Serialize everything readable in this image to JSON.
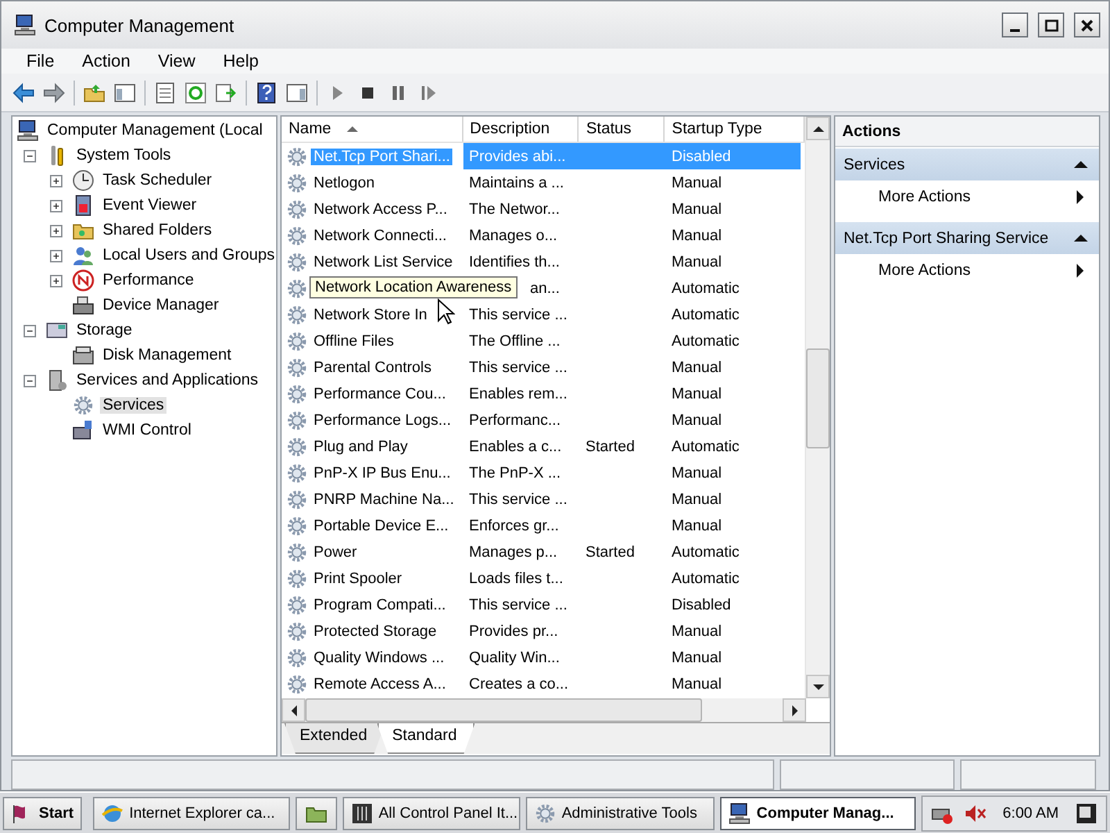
{
  "window": {
    "title": "Computer Management"
  },
  "menu": [
    "File",
    "Action",
    "View",
    "Help"
  ],
  "tree": [
    {
      "label": "Computer Management (Local",
      "selected": false,
      "children": [
        {
          "label": "System Tools",
          "expanded": true,
          "selected": false,
          "children": [
            {
              "label": "Task Scheduler",
              "expanded": false,
              "selected": false
            },
            {
              "label": "Event Viewer",
              "expanded": false,
              "selected": false
            },
            {
              "label": "Shared Folders",
              "expanded": false,
              "selected": false
            },
            {
              "label": "Local Users and Groups",
              "expanded": false,
              "selected": false
            },
            {
              "label": "Performance",
              "expanded": false,
              "selected": false
            },
            {
              "label": "Device Manager",
              "selected": false
            }
          ]
        },
        {
          "label": "Storage",
          "expanded": true,
          "selected": false,
          "children": [
            {
              "label": "Disk Management",
              "selected": false
            }
          ]
        },
        {
          "label": "Services and Applications",
          "expanded": true,
          "selected": false,
          "children": [
            {
              "label": "Services",
              "selected": true
            },
            {
              "label": "WMI Control",
              "selected": false
            }
          ]
        }
      ]
    }
  ],
  "list": {
    "columns": [
      {
        "label": "Name",
        "sorted": true
      },
      {
        "label": "Description",
        "sorted": false
      },
      {
        "label": "Status",
        "sorted": false
      },
      {
        "label": "Startup Type",
        "sorted": false
      }
    ],
    "rows": [
      {
        "name": "Net.Tcp Port Shari...",
        "description": "Provides abi...",
        "status": "",
        "startup_type": "Disabled",
        "selected": true
      },
      {
        "name": "Netlogon",
        "description": "Maintains a ...",
        "startup_type": "Manual",
        "selected": false
      },
      {
        "name": "Network Access P...",
        "description": "The Networ...",
        "startup_type": "Manual",
        "selected": false
      },
      {
        "name": "Network Connecti...",
        "description": "Manages o...",
        "startup_type": "Manual",
        "selected": false
      },
      {
        "name": "Network List Service",
        "description": "Identifies th...",
        "startup_type": "Manual",
        "selected": false
      },
      {
        "description": "an...",
        "startup_type": "Automatic",
        "selected": false
      },
      {
        "name": "Network Store In",
        "description": "This service ...",
        "startup_type": "Automatic",
        "selected": false
      },
      {
        "name": "Offline Files",
        "description": "The Offline ...",
        "startup_type": "Automatic",
        "selected": false
      },
      {
        "name": "Parental Controls",
        "description": "This service ...",
        "startup_type": "Manual",
        "selected": false
      },
      {
        "name": "Performance Cou...",
        "description": "Enables rem...",
        "startup_type": "Manual",
        "selected": false
      },
      {
        "name": "Performance Logs...",
        "description": "Performanc...",
        "startup_type": "Manual",
        "selected": false
      },
      {
        "name": "Plug and Play",
        "description": "Enables a c...",
        "status": "Started",
        "startup_type": "Automatic",
        "selected": false
      },
      {
        "name": "PnP-X IP Bus Enu...",
        "description": "The PnP-X ...",
        "startup_type": "Manual",
        "selected": false
      },
      {
        "name": "PNRP Machine Na...",
        "description": "This service ...",
        "startup_type": "Manual",
        "selected": false
      },
      {
        "name": "Portable Device E...",
        "description": "Enforces gr...",
        "startup_type": "Manual",
        "selected": false
      },
      {
        "name": "Power",
        "description": "Manages p...",
        "status": "Started",
        "startup_type": "Automatic",
        "selected": false
      },
      {
        "name": "Print Spooler",
        "description": "Loads files t...",
        "startup_type": "Automatic",
        "selected": false
      },
      {
        "name": "Program Compati...",
        "description": "This service ...",
        "startup_type": "Disabled",
        "selected": false
      },
      {
        "name": "Protected Storage",
        "description": "Provides pr...",
        "startup_type": "Manual",
        "selected": false
      },
      {
        "name": "Quality Windows ...",
        "description": "Quality Win...",
        "startup_type": "Manual",
        "selected": false
      },
      {
        "name": "Remote Access A...",
        "description": "Creates a co...",
        "startup_type": "Manual",
        "selected": false
      }
    ],
    "tooltip": "Network Location Awareness",
    "tabs": [
      {
        "label": "Extended",
        "selected": false
      },
      {
        "label": "Standard",
        "selected": true
      }
    ]
  },
  "actions": {
    "title": "Actions",
    "sections": [
      {
        "title": "Services",
        "items": [
          "More Actions"
        ]
      },
      {
        "title": "Net.Tcp Port Sharing Service",
        "items": [
          "More Actions"
        ]
      }
    ]
  },
  "taskbar": {
    "start": "Start",
    "buttons": [
      {
        "label": "Internet Explorer ca...",
        "selected": false
      },
      {
        "selected": false
      },
      {
        "label": "All Control Panel It...",
        "selected": false
      },
      {
        "label": "Administrative Tools",
        "selected": false
      },
      {
        "label": "Computer Manag...",
        "selected": true
      }
    ],
    "clock": "6:00 AM"
  }
}
